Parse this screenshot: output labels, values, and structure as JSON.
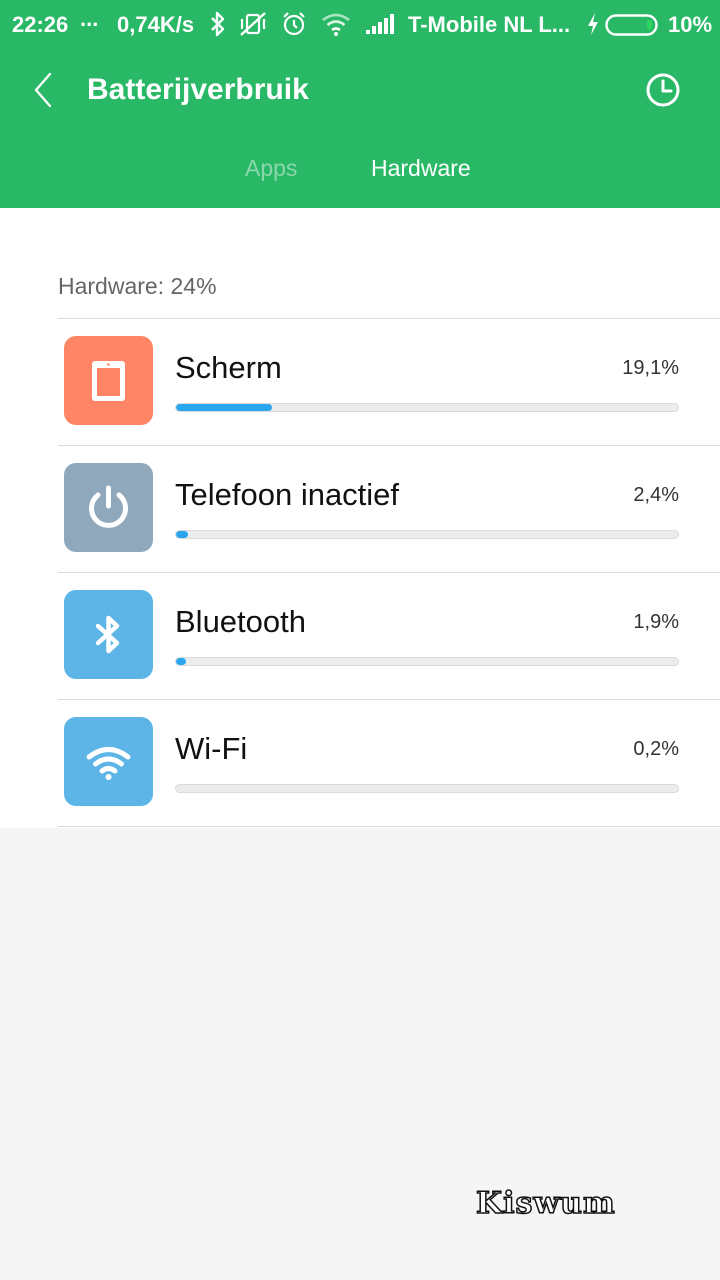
{
  "status_bar": {
    "time": "22:26",
    "dots": "...",
    "net_speed": "0,74K/s",
    "carrier": "T-Mobile  NL L...",
    "battery": "10%",
    "icons": [
      "bluetooth-icon",
      "vibrate-off-icon",
      "alarm-icon",
      "wifi-icon",
      "signal-icon",
      "charging-icon",
      "battery-icon"
    ]
  },
  "header": {
    "title": "Batterijverbruik",
    "icons": [
      "back-icon",
      "history-clock-icon"
    ],
    "tabs": [
      {
        "label": "Apps",
        "active": false
      },
      {
        "label": "Hardware",
        "active": true
      }
    ]
  },
  "summary": "Hardware: 24%",
  "items": [
    {
      "label": "Scherm",
      "percent": "19,1%",
      "level": 19.1,
      "icon": "screen-icon",
      "color": "#ff8566"
    },
    {
      "label": "Telefoon inactief",
      "percent": "2,4%",
      "level": 2.4,
      "icon": "power-icon",
      "color": "#90a8bc"
    },
    {
      "label": "Bluetooth",
      "percent": "1,9%",
      "level": 1.9,
      "icon": "bluetooth-icon",
      "color": "#5cb5e6"
    },
    {
      "label": "Wi-Fi",
      "percent": "0,2%",
      "level": 0.2,
      "icon": "wifi-icon",
      "color": "#5cb5e6"
    }
  ],
  "watermark": "Kiswum",
  "colors": {
    "accent": "#29b866",
    "bar_fill": "#2aa6ee"
  }
}
